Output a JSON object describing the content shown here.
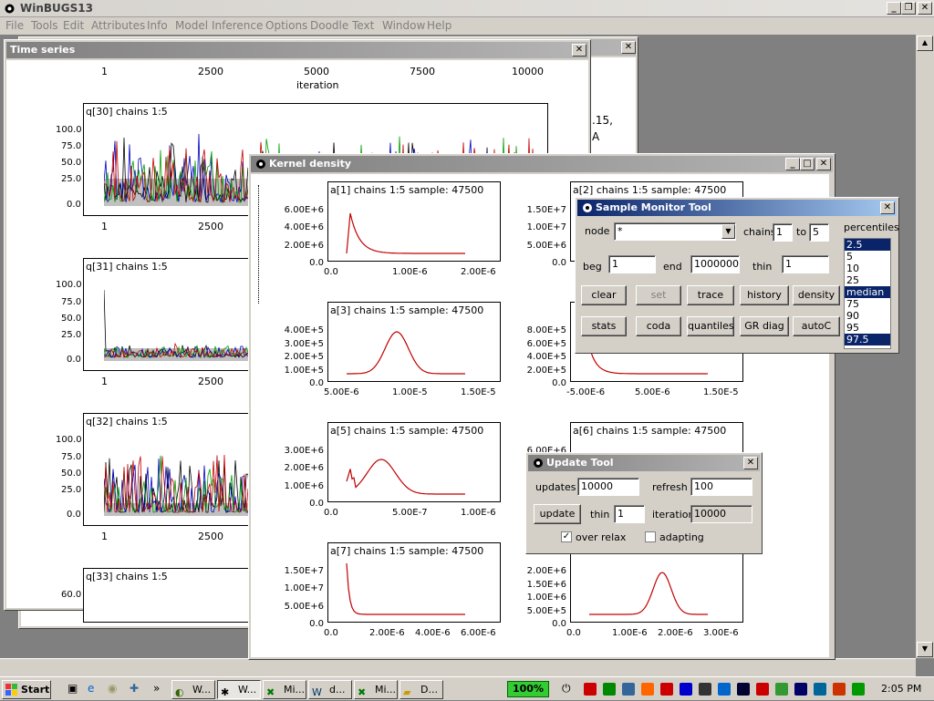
{
  "app": {
    "title": "WinBUGS13"
  },
  "menu": [
    "File",
    "Tools",
    "Edit",
    "Attributes",
    "Info",
    "Model",
    "Inference",
    "Options",
    "Doodle",
    "Text",
    "Window",
    "Help"
  ],
  "time_series": {
    "title": "Time series",
    "top_axis": {
      "ticks": [
        "1",
        "2500",
        "5000",
        "7500",
        "10000"
      ],
      "label": "iteration"
    },
    "plots": [
      {
        "title": "q[30] chains 1:5",
        "yticks": [
          "100.0",
          "75.0",
          "50.0",
          "25.0",
          "0.0"
        ],
        "xticks": [
          "1",
          "2500"
        ]
      },
      {
        "title": "q[31] chains 1:5",
        "yticks": [
          "100.0",
          "75.0",
          "50.0",
          "25.0",
          "0.0"
        ],
        "xticks": [
          "1",
          "2500"
        ]
      },
      {
        "title": "q[32] chains 1:5",
        "yticks": [
          "100.0",
          "75.0",
          "50.0",
          "25.0",
          "0.0"
        ],
        "xticks": [
          "1",
          "2500"
        ]
      },
      {
        "title": "q[33] chains 1:5",
        "yticks": [
          "60.0"
        ],
        "xticks": []
      }
    ]
  },
  "background_window": {
    "text": [
      ".15,",
      "A"
    ]
  },
  "kernel_density": {
    "title": "Kernel density",
    "plots": [
      {
        "title": "a[1] chains 1:5 sample: 47500",
        "yticks": [
          "6.00E+6",
          "4.00E+6",
          "2.00E+6",
          "0.0"
        ],
        "xticks": [
          "0.0",
          "1.00E-6",
          "2.00E-6"
        ]
      },
      {
        "title": "a[2] chains 1:5 sample: 47500",
        "yticks": [
          "1.50E+7",
          "1.00E+7",
          "5.00E+6",
          "0.0"
        ],
        "xticks": []
      },
      {
        "title": "a[3] chains 1:5 sample: 47500",
        "yticks": [
          "4.00E+5",
          "3.00E+5",
          "2.00E+5",
          "1.00E+5",
          "0.0"
        ],
        "xticks": [
          "5.00E-6",
          "1.00E-5",
          "1.50E-5"
        ]
      },
      {
        "title": "",
        "yticks": [
          "8.00E+5",
          "6.00E+5",
          "4.00E+5",
          "2.00E+5",
          "0.0"
        ],
        "xticks": [
          "-5.00E-6",
          "5.00E-6",
          "1.50E-5"
        ]
      },
      {
        "title": "a[5] chains 1:5 sample: 47500",
        "yticks": [
          "3.00E+6",
          "2.00E+6",
          "1.00E+6",
          "0.0"
        ],
        "xticks": [
          "0.0",
          "5.00E-7",
          "1.00E-6"
        ]
      },
      {
        "title": "a[6] chains 1:5 sample: 47500",
        "yticks": [
          "6.00E+6"
        ],
        "xticks": []
      },
      {
        "title": "a[7] chains 1:5 sample: 47500",
        "yticks": [
          "1.50E+7",
          "1.00E+7",
          "5.00E+6",
          "0.0"
        ],
        "xticks": [
          "0.0",
          "2.00E-6",
          "4.00E-6",
          "6.00E-6"
        ]
      },
      {
        "title": "",
        "yticks": [
          "2.00E+6",
          "1.50E+6",
          "1.00E+6",
          "5.00E+5",
          "0.0"
        ],
        "xticks": [
          "0.0",
          "1.00E-6",
          "2.00E-6",
          "3.00E-6"
        ]
      }
    ]
  },
  "sample_monitor": {
    "title": "Sample Monitor Tool",
    "node_label": "node",
    "node_value": "*",
    "chains_label": "chains",
    "chains_from": "1",
    "to_label": "to",
    "chains_to": "5",
    "beg_label": "beg",
    "beg_value": "1",
    "end_label": "end",
    "end_value": "1000000",
    "thin_label": "thin",
    "thin_value": "1",
    "percentiles_label": "percentiles",
    "percentiles": [
      "2.5",
      "5",
      "10",
      "25",
      "median",
      "75",
      "90",
      "95",
      "97.5"
    ],
    "buttons_row1": [
      "clear",
      "set",
      "trace",
      "history",
      "density"
    ],
    "buttons_row2": [
      "stats",
      "coda",
      "quantiles",
      "GR diag",
      "autoC"
    ]
  },
  "update_tool": {
    "title": "Update Tool",
    "updates_label": "updates",
    "updates_value": "10000",
    "refresh_label": "refresh",
    "refresh_value": "100",
    "update_button": "update",
    "thin_label": "thin",
    "thin_value": "1",
    "iteration_label": "iteration",
    "iteration_value": "10000",
    "over_relax_label": "over relax",
    "over_relax_checked": true,
    "adapting_label": "adapting",
    "adapting_checked": false
  },
  "taskbar": {
    "start_label": "Start",
    "tasks": [
      "W...",
      "W...",
      "Mi...",
      "d...",
      "Mi...",
      "D..."
    ],
    "battery": "100%",
    "clock": "2:05 PM"
  }
}
